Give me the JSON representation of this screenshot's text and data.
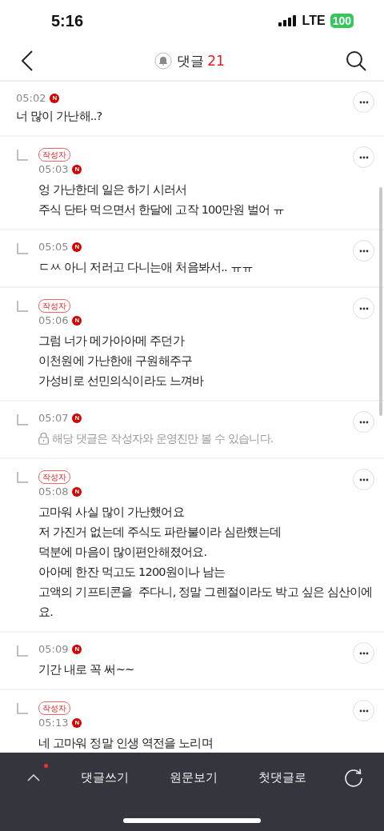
{
  "status_bar": {
    "time": "5:16",
    "network": "LTE",
    "battery": "100"
  },
  "header": {
    "title": "댓글",
    "count": "21"
  },
  "comments": [
    {
      "reply": false,
      "time": "05:02",
      "badge": "N",
      "locked": false,
      "text": "너 많이 가난해..?"
    },
    {
      "reply": true,
      "author_tag": "작성자",
      "time": "05:03",
      "badge": "N",
      "locked": false,
      "text": "엉 가난한데 일은 하기 시러서\n주식 단타 먹으면서 한달에 고작 100만원 벌어 ㅠ"
    },
    {
      "reply": true,
      "time": "05:05",
      "badge": "N",
      "locked": false,
      "text": "ㄷㅆ 아니 저러고 다니는애 처음봐서.. ㅠㅠ"
    },
    {
      "reply": true,
      "author_tag": "작성자",
      "time": "05:06",
      "badge": "N",
      "locked": false,
      "text": "그럼 너가 메가아아메 주던가\n이천원에 가난한애 구원해주구\n가성비로 선민의식이라도 느껴바"
    },
    {
      "reply": true,
      "time": "05:07",
      "badge": "N",
      "locked": true,
      "text": "해당 댓글은 작성자와 운영진만 볼 수 있습니다."
    },
    {
      "reply": true,
      "author_tag": "작성자",
      "time": "05:08",
      "badge": "N",
      "locked": false,
      "text": "고마워 사실 많이 가난했어요\n저 가진거 없는데 주식도 파란불이라 심란했는데\n덕분에 마음이 많이편안해졌어요.\n아아메 한잔 먹고도 1200원이나 남는\n고액의 기프티콘을  주다니, 정말 그렌절이라도 박고 싶은 심산이에\n요."
    },
    {
      "reply": true,
      "time": "05:09",
      "badge": "N",
      "locked": false,
      "text": "기간 내로 꼭 써~~"
    },
    {
      "reply": true,
      "author_tag": "작성자",
      "time": "05:13",
      "badge": "N",
      "locked": false,
      "text": "네 고마워 정말 인생 역전을 노리며"
    }
  ],
  "bottom_bar": {
    "new_dot": true,
    "actions": [
      "댓글쓰기",
      "원문보기",
      "첫댓글로"
    ]
  }
}
